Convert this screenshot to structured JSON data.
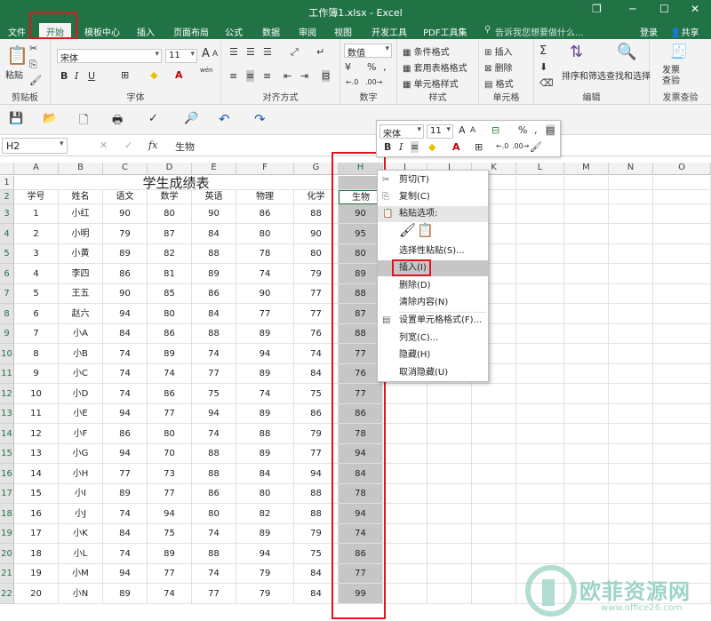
{
  "window": {
    "title": "工作簿1.xlsx - Excel",
    "restore": "❐",
    "minimize": "─",
    "maximize": "☐",
    "close": "✕"
  },
  "tabs": [
    "文件",
    "开始",
    "模板中心",
    "插入",
    "页面布局",
    "公式",
    "数据",
    "审阅",
    "视图",
    "开发工具",
    "PDF工具集"
  ],
  "search_placeholder": "告诉我您想要做什么...",
  "login": "登录",
  "share": "共享",
  "ribbon": {
    "clipboard": {
      "paste": "粘贴",
      "label": "剪贴板"
    },
    "font": {
      "name": "宋体",
      "size": "11",
      "bold": "B",
      "italic": "I",
      "underline": "U",
      "grow": "A",
      "shrink": "A",
      "wen": "wén",
      "label": "字体"
    },
    "align": {
      "label": "对齐方式"
    },
    "number": {
      "format": "数值",
      "label": "数字"
    },
    "styles": {
      "cond": "条件格式",
      "table": "套用表格格式",
      "cell": "单元格样式",
      "label": "样式"
    },
    "cells": {
      "insert": "插入",
      "delete": "删除",
      "format": "格式",
      "label": "单元格"
    },
    "edit": {
      "sort": "排序和筛选",
      "find": "查找和选择",
      "label": "编辑"
    },
    "invoice": {
      "btn": "发票\n查验",
      "label": "发票查验"
    }
  },
  "formula": {
    "cell": "H2",
    "value": "生物",
    "fx": "fx",
    "cancel": "✕",
    "enter": "✓"
  },
  "columns": [
    "A",
    "B",
    "C",
    "D",
    "E",
    "F",
    "G",
    "H",
    "I",
    "J",
    "K",
    "L",
    "M",
    "N",
    "O"
  ],
  "sheet_title": "学生成绩表",
  "headers": [
    "学号",
    "姓名",
    "语文",
    "数学",
    "英语",
    "物理",
    "化学",
    "生物"
  ],
  "rows": [
    [
      "1",
      "小红",
      "90",
      "80",
      "90",
      "86",
      "88",
      "90"
    ],
    [
      "2",
      "小明",
      "79",
      "87",
      "84",
      "80",
      "90",
      "95"
    ],
    [
      "3",
      "小黄",
      "89",
      "82",
      "88",
      "78",
      "80",
      "80"
    ],
    [
      "4",
      "李四",
      "86",
      "81",
      "89",
      "74",
      "79",
      "89"
    ],
    [
      "5",
      "王五",
      "90",
      "85",
      "86",
      "90",
      "77",
      "88"
    ],
    [
      "6",
      "赵六",
      "94",
      "80",
      "84",
      "77",
      "77",
      "87"
    ],
    [
      "7",
      "小A",
      "84",
      "86",
      "88",
      "89",
      "76",
      "88"
    ],
    [
      "8",
      "小B",
      "74",
      "89",
      "74",
      "94",
      "74",
      "77"
    ],
    [
      "9",
      "小C",
      "74",
      "74",
      "77",
      "89",
      "84",
      "76"
    ],
    [
      "10",
      "小D",
      "74",
      "86",
      "75",
      "74",
      "75",
      "77"
    ],
    [
      "11",
      "小E",
      "94",
      "77",
      "94",
      "89",
      "86",
      "86"
    ],
    [
      "12",
      "小F",
      "86",
      "80",
      "74",
      "88",
      "79",
      "78"
    ],
    [
      "13",
      "小G",
      "94",
      "70",
      "88",
      "89",
      "77",
      "94"
    ],
    [
      "14",
      "小H",
      "77",
      "73",
      "88",
      "84",
      "94",
      "84"
    ],
    [
      "15",
      "小I",
      "89",
      "77",
      "86",
      "80",
      "88",
      "78"
    ],
    [
      "16",
      "小J",
      "74",
      "94",
      "80",
      "82",
      "88",
      "94"
    ],
    [
      "17",
      "小K",
      "84",
      "75",
      "74",
      "89",
      "79",
      "74"
    ],
    [
      "18",
      "小L",
      "74",
      "89",
      "88",
      "94",
      "75",
      "86"
    ],
    [
      "19",
      "小M",
      "94",
      "77",
      "74",
      "79",
      "84",
      "77"
    ],
    [
      "20",
      "小N",
      "89",
      "74",
      "77",
      "79",
      "84",
      "99"
    ]
  ],
  "mini_toolbar": {
    "font": "宋体",
    "size": "11",
    "percent": "%",
    "comma": ","
  },
  "context_menu": [
    {
      "label": "剪切(T)",
      "icon": "scissors-icon"
    },
    {
      "label": "复制(C)",
      "icon": "copy-icon"
    },
    {
      "label": "粘贴选项:",
      "icon": "paste-icon"
    },
    {
      "label": "",
      "icon": ""
    },
    {
      "label": "选择性粘贴(S)...",
      "icon": ""
    },
    {
      "label": "插入(I)",
      "icon": ""
    },
    {
      "label": "删除(D)",
      "icon": ""
    },
    {
      "label": "清除内容(N)",
      "icon": ""
    },
    {
      "label": "设置单元格格式(F)...",
      "icon": "format-cells-icon"
    },
    {
      "label": "列宽(C)...",
      "icon": ""
    },
    {
      "label": "隐藏(H)",
      "icon": ""
    },
    {
      "label": "取消隐藏(U)",
      "icon": ""
    }
  ],
  "watermark": {
    "cn": "欧菲资源网",
    "url": "www.office26.com"
  },
  "colors": {
    "excel_green": "#217346",
    "highlight": "#e0141e",
    "selection": "#c6c6c6"
  }
}
